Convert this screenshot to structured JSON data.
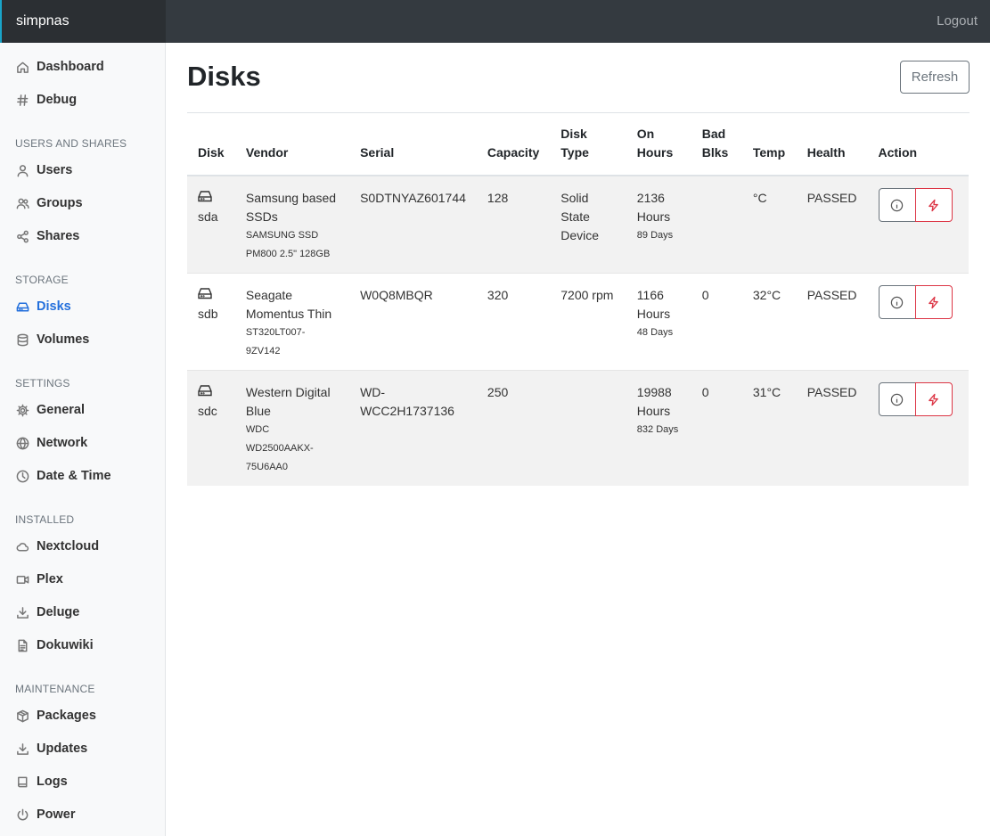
{
  "app": {
    "brand": "simpnas",
    "logout": "Logout"
  },
  "sidebar": {
    "top": [
      {
        "label": "Dashboard",
        "icon": "home-icon"
      },
      {
        "label": "Debug",
        "icon": "hash-icon"
      }
    ],
    "sections": [
      {
        "title": "USERS AND SHARES",
        "items": [
          {
            "label": "Users",
            "icon": "user-icon"
          },
          {
            "label": "Groups",
            "icon": "users-icon"
          },
          {
            "label": "Shares",
            "icon": "share-icon"
          }
        ]
      },
      {
        "title": "STORAGE",
        "items": [
          {
            "label": "Disks",
            "icon": "hard-drive-icon",
            "active": true
          },
          {
            "label": "Volumes",
            "icon": "database-icon"
          }
        ]
      },
      {
        "title": "SETTINGS",
        "items": [
          {
            "label": "General",
            "icon": "gear-icon"
          },
          {
            "label": "Network",
            "icon": "globe-icon"
          },
          {
            "label": "Date & Time",
            "icon": "clock-icon"
          }
        ]
      },
      {
        "title": "INSTALLED",
        "items": [
          {
            "label": "Nextcloud",
            "icon": "cloud-icon"
          },
          {
            "label": "Plex",
            "icon": "video-icon"
          },
          {
            "label": "Deluge",
            "icon": "download-icon"
          },
          {
            "label": "Dokuwiki",
            "icon": "file-text-icon"
          }
        ]
      },
      {
        "title": "MAINTENANCE",
        "items": [
          {
            "label": "Packages",
            "icon": "package-icon"
          },
          {
            "label": "Updates",
            "icon": "download-icon"
          },
          {
            "label": "Logs",
            "icon": "book-icon"
          },
          {
            "label": "Power",
            "icon": "power-icon"
          }
        ]
      }
    ]
  },
  "page": {
    "title": "Disks",
    "refresh": "Refresh"
  },
  "table": {
    "headers": {
      "disk": "Disk",
      "vendor": "Vendor",
      "serial": "Serial",
      "capacity": "Capacity",
      "type": "Disk Type",
      "hours_1": "On",
      "hours_2": "Hours",
      "bad_1": "Bad",
      "bad_2": "Blks",
      "temp": "Temp",
      "health": "Health",
      "action": "Action"
    },
    "rows": [
      {
        "disk": "sda",
        "vendor": "Samsung based SSDs",
        "model": "SAMSUNG SSD PM800 2.5\" 128GB",
        "serial": "S0DTNYAZ601744",
        "capacity": "128",
        "type": "Solid State Device",
        "hours": "2136 Hours",
        "days": "89 Days",
        "bad": "",
        "temp": "°C",
        "health": "PASSED"
      },
      {
        "disk": "sdb",
        "vendor": "Seagate Momentus Thin",
        "model": "ST320LT007-9ZV142",
        "serial": "W0Q8MBQR",
        "capacity": "320",
        "type": "7200 rpm",
        "hours": "1166 Hours",
        "days": "48 Days",
        "bad": "0",
        "temp": "32°C",
        "health": "PASSED"
      },
      {
        "disk": "sdc",
        "vendor": "Western Digital Blue",
        "model": "WDC WD2500AAKX-75U6AA0",
        "serial": "WD-WCC2H1737136",
        "capacity": "250",
        "type": "",
        "hours": "19988 Hours",
        "days": "832 Days",
        "bad": "0",
        "temp": "31°C",
        "health": "PASSED"
      }
    ]
  },
  "colors": {
    "topbar": "#343a40",
    "active": "#2470dc",
    "passed": "#28a745",
    "danger": "#dc3545"
  }
}
